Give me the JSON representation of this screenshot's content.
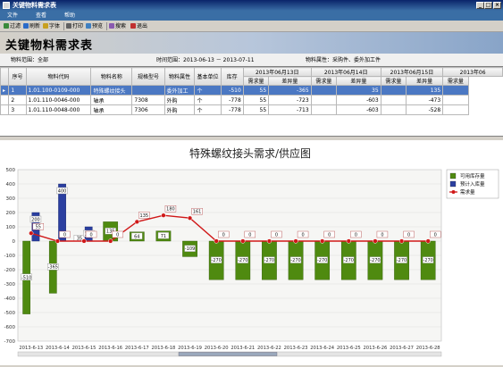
{
  "window": {
    "title": "关键物料需求表",
    "min": "_",
    "max": "□",
    "close": "×"
  },
  "menu": [
    "文件",
    "查看",
    "帮助"
  ],
  "toolbar": {
    "filter": "过滤",
    "refresh": "刷新",
    "font": "字体",
    "print": "打印",
    "preview": "预览",
    "search": "搜索",
    "exit": "退出"
  },
  "page_title": "关键物料需求表",
  "filters": {
    "material_range": "物料范围：全部",
    "time_range": "时间范围：2013-06-13 － 2013-07-11",
    "attribute": "物料属性：采购件、委外加工件"
  },
  "grid": {
    "columns": [
      "序号",
      "物料代码",
      "物料名称",
      "规格型号",
      "物料属性",
      "基本单位",
      "库存"
    ],
    "date_headers": [
      "2013年06月13日",
      "2013年06月14日",
      "2013年06月15日",
      "2013年06"
    ],
    "sub_headers": [
      "需求量",
      "差异量",
      "需求量",
      "差异量",
      "需求量",
      "差异量",
      "需求量"
    ],
    "rows": [
      {
        "no": "1",
        "code": "1.01.100-0109-000",
        "name": "特殊螺纹接头",
        "spec": "",
        "attr": "委外加工",
        "unit": "个",
        "stock": "-510",
        "d1": "55",
        "v1": "-365",
        "d2": "",
        "v2": "35",
        "d3": "",
        "v3": "135",
        "d4": ""
      },
      {
        "no": "2",
        "code": "1.01.110-0046-000",
        "name": "轴承",
        "spec": "7308",
        "attr": "外购",
        "unit": "个",
        "stock": "-778",
        "d1": "55",
        "v1": "-723",
        "d2": "",
        "v2": "-603",
        "d3": "",
        "v3": "-473",
        "d4": ""
      },
      {
        "no": "3",
        "code": "1.01.110-0048-000",
        "name": "轴承",
        "spec": "7306",
        "attr": "外购",
        "unit": "个",
        "stock": "-778",
        "d1": "55",
        "v1": "-713",
        "d2": "",
        "v2": "-603",
        "d3": "",
        "v3": "-528",
        "d4": ""
      }
    ]
  },
  "chart_data": {
    "type": "bar",
    "title": "特殊螺纹接头需求/供应图",
    "categories": [
      "2013-6-13",
      "2013-6-14",
      "2013-6-15",
      "2013-6-16",
      "2013-6-17",
      "2013-6-18",
      "2013-6-19",
      "2013-6-20",
      "2013-6-21",
      "2013-6-22",
      "2013-6-23",
      "2013-6-24",
      "2013-6-25",
      "2013-6-26",
      "2013-6-27",
      "2013-6-28"
    ],
    "ylim": [
      -700,
      500
    ],
    "yticks": [
      500,
      400,
      300,
      200,
      100,
      0,
      -100,
      -200,
      -300,
      -400,
      -500,
      -600,
      -700
    ],
    "series": [
      {
        "name": "可用库存量",
        "kind": "bar",
        "color": "#4f8a10",
        "values": [
          -510,
          -365,
          35,
          135,
          64,
          71,
          -109,
          -270,
          -270,
          -270,
          -270,
          -270,
          -270,
          -270,
          -270,
          -270
        ]
      },
      {
        "name": "预计入库量",
        "kind": "bar",
        "color": "#2b3fa0",
        "values": [
          200,
          400,
          100,
          null,
          null,
          null,
          null,
          null,
          null,
          null,
          null,
          null,
          null,
          null,
          null,
          null
        ]
      },
      {
        "name": "需求量",
        "kind": "line",
        "color": "#d01818",
        "values": [
          55,
          0,
          0,
          0,
          135,
          180,
          161,
          0,
          0,
          0,
          0,
          0,
          0,
          0,
          0,
          0
        ]
      }
    ],
    "legend": "top-right",
    "grid": true
  }
}
